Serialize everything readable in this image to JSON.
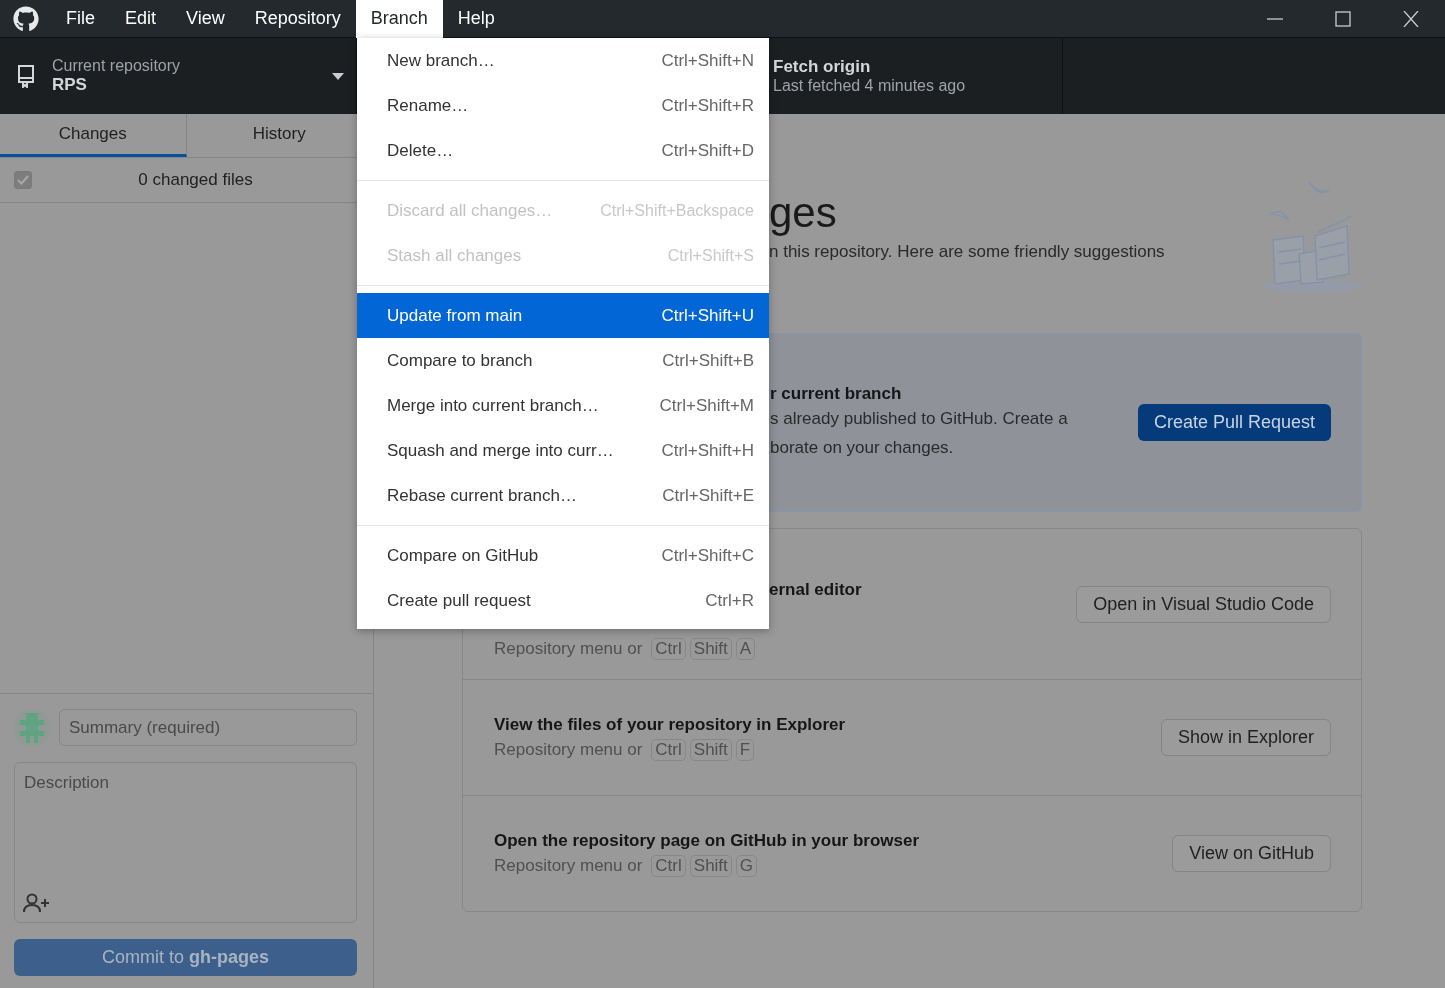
{
  "menubar": [
    {
      "label": "File",
      "selected": false
    },
    {
      "label": "Edit",
      "selected": false
    },
    {
      "label": "View",
      "selected": false
    },
    {
      "label": "Repository",
      "selected": false
    },
    {
      "label": "Branch",
      "selected": true
    },
    {
      "label": "Help",
      "selected": false
    }
  ],
  "toolbar": {
    "repository": {
      "label": "Current repository",
      "value": "RPS"
    },
    "fetch": {
      "title": "Fetch origin",
      "subtitle": "Last fetched 4 minutes ago"
    }
  },
  "sidebar": {
    "tabs": [
      {
        "label": "Changes",
        "selected": true
      },
      {
        "label": "History",
        "selected": false
      }
    ],
    "changes": {
      "checked": true,
      "label": "0 changed files"
    },
    "commit": {
      "summary_placeholder": "Summary (required)",
      "description_placeholder": "Description",
      "button": "Commit to **gh-pages**"
    }
  },
  "menu": {
    "items": [
      {
        "kind": "item",
        "label": "New branch…",
        "shortcut": "Ctrl+Shift+N",
        "disabled": false,
        "selected": false
      },
      {
        "kind": "item",
        "label": "Rename…",
        "shortcut": "Ctrl+Shift+R",
        "disabled": false,
        "selected": false
      },
      {
        "kind": "item",
        "label": "Delete…",
        "shortcut": "Ctrl+Shift+D",
        "disabled": false,
        "selected": false
      },
      {
        "kind": "separator"
      },
      {
        "kind": "item",
        "label": "Discard all changes…",
        "shortcut": "Ctrl+Shift+Backspace",
        "disabled": true,
        "selected": false
      },
      {
        "kind": "item",
        "label": "Stash all changes",
        "shortcut": "Ctrl+Shift+S",
        "disabled": true,
        "selected": false
      },
      {
        "kind": "separator"
      },
      {
        "kind": "item",
        "label": "Update from main",
        "shortcut": "Ctrl+Shift+U",
        "disabled": false,
        "selected": true
      },
      {
        "kind": "item",
        "label": "Compare to branch",
        "shortcut": "Ctrl+Shift+B",
        "disabled": false,
        "selected": false
      },
      {
        "kind": "item",
        "label": "Merge into current branch…",
        "shortcut": "Ctrl+Shift+M",
        "disabled": false,
        "selected": false
      },
      {
        "kind": "item",
        "label": "Squash and merge into curr…",
        "shortcut": "Ctrl+Shift+H",
        "disabled": false,
        "selected": false
      },
      {
        "kind": "item",
        "label": "Rebase current branch…",
        "shortcut": "Ctrl+Shift+E",
        "disabled": false,
        "selected": false
      },
      {
        "kind": "separator"
      },
      {
        "kind": "item",
        "label": "Compare on GitHub",
        "shortcut": "Ctrl+Shift+C",
        "disabled": false,
        "selected": false
      },
      {
        "kind": "item",
        "label": "Create pull request",
        "shortcut": "Ctrl+R",
        "disabled": false,
        "selected": false
      }
    ]
  },
  "main": {
    "heading": "ges",
    "subtitle": "n this repository. Here are some friendly suggestions",
    "highlight": {
      "title": "r current branch",
      "lines": [
        "s already published to GitHub. Create a",
        "borate on your changes."
      ],
      "button": "Create Pull Request"
    },
    "suggestions": [
      {
        "title": "ernal editor",
        "hint": "Repository menu or",
        "keys": [
          "Ctrl",
          "Shift",
          "A"
        ],
        "button": "Open in Visual Studio Code"
      },
      {
        "title": "View the files of your repository in Explorer",
        "hint": "Repository menu or",
        "keys": [
          "Ctrl",
          "Shift",
          "F"
        ],
        "button": "Show in Explorer"
      },
      {
        "title": "Open the repository page on GitHub in your browser",
        "hint": "Repository menu or",
        "keys": [
          "Ctrl",
          "Shift",
          "G"
        ],
        "button": "View on GitHub"
      }
    ]
  }
}
